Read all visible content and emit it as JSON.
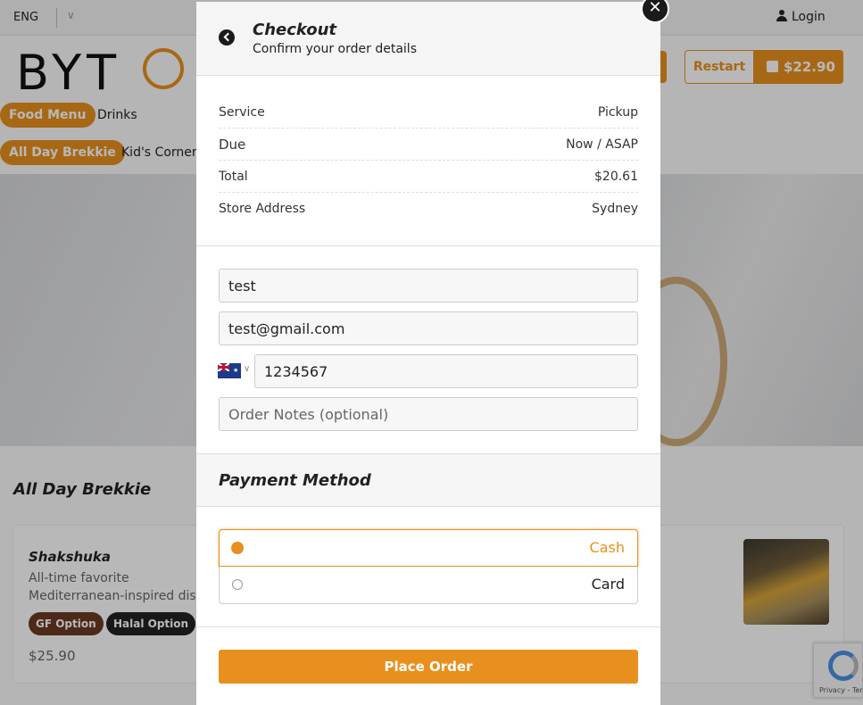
{
  "background": {
    "topbar": {
      "language": "ENG",
      "login_label": "Login"
    },
    "logo_text": "BYT",
    "header": {
      "restart_label": "Restart",
      "cart_total": "$22.90"
    },
    "menu_tabs": [
      {
        "label": "Food Menu",
        "active": true
      },
      {
        "label": "Drinks",
        "active": false
      }
    ],
    "category_tabs": [
      {
        "label": "All Day Brekkie",
        "active": true
      },
      {
        "label": "Kid's Corner",
        "active": false
      }
    ],
    "section_title": "All Day Brekkie",
    "product": {
      "name": "Shakshuka",
      "description_line1": "All-time favorite",
      "description_line2": "Mediterranean-inspired dis",
      "tags": [
        "GF Option",
        "Halal Option"
      ],
      "price": "$25.90"
    },
    "recaptcha_text": "Privacy - Terms"
  },
  "modal": {
    "title": "Checkout",
    "subtitle": "Confirm your order details",
    "summary": [
      {
        "label": "Service",
        "value": "Pickup"
      },
      {
        "label": "Due",
        "value": "Now / ASAP"
      },
      {
        "label": "Total",
        "value": "$20.61"
      },
      {
        "label": "Store Address",
        "value": "Sydney"
      }
    ],
    "form": {
      "name_value": "test",
      "email_value": "test@gmail.com",
      "phone_value": "1234567",
      "notes_placeholder": "Order Notes (optional)"
    },
    "payment": {
      "title": "Payment Method",
      "options": [
        {
          "label": "Cash",
          "selected": true
        },
        {
          "label": "Card",
          "selected": false
        }
      ]
    },
    "place_order_label": "Place Order"
  },
  "colors": {
    "accent": "#e8901e",
    "dark": "#1a1a1a"
  }
}
